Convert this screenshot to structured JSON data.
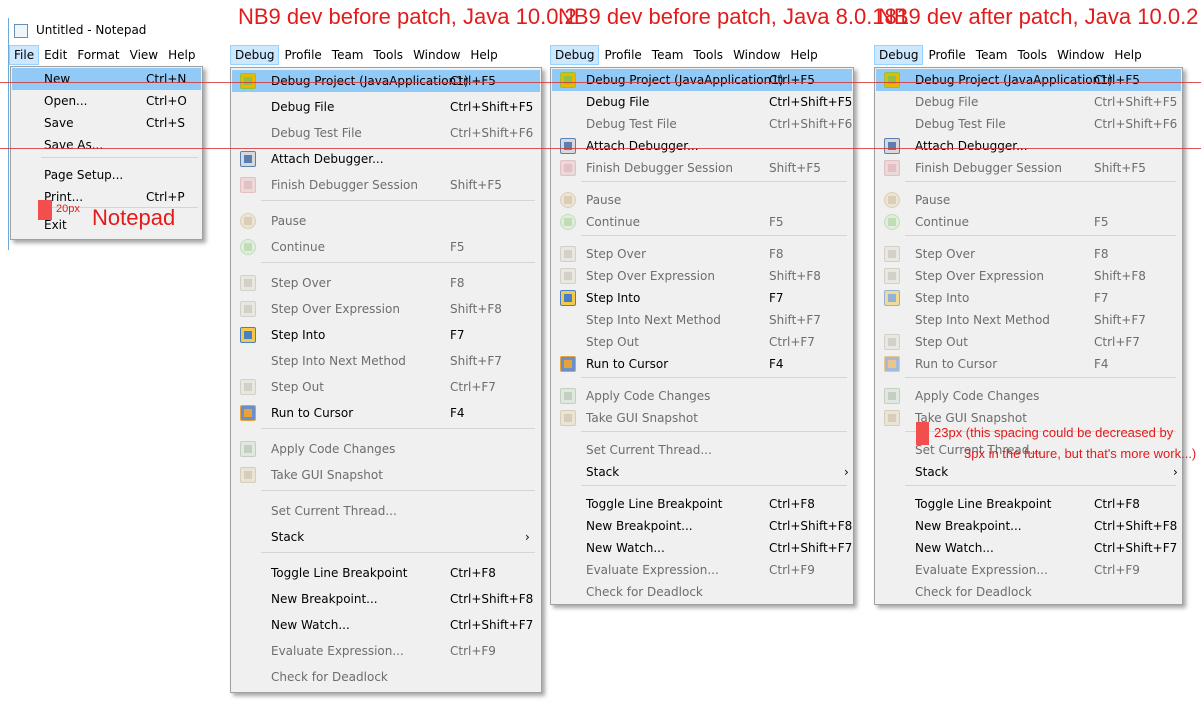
{
  "headings": [
    "NB9 dev before patch, Java 10.0.2",
    "NB9 dev before patch, Java 8.0.181",
    "NB9 dev after patch, Java 10.0.2"
  ],
  "notepad": {
    "title": "Untitled - Notepad",
    "menubar": [
      "File",
      "Edit",
      "Format",
      "View",
      "Help"
    ],
    "menu": [
      {
        "label": "New",
        "acc": "Ctrl+N",
        "selected": true
      },
      {
        "label": "Open...",
        "acc": "Ctrl+O"
      },
      {
        "label": "Save",
        "acc": "Ctrl+S"
      },
      {
        "label": "Save As...",
        "acc": ""
      },
      {
        "label": "Page Setup...",
        "acc": ""
      },
      {
        "label": "Print...",
        "acc": "Ctrl+P"
      },
      {
        "label": "Exit",
        "acc": ""
      }
    ],
    "spacing_note": "20px",
    "label_note": "Notepad"
  },
  "nb_menubar": [
    "Debug",
    "Profile",
    "Team",
    "Tools",
    "Window",
    "Help"
  ],
  "panels": [
    {
      "items": [
        {
          "label": "Debug Project (JavaApplication1)",
          "acc": "Ctrl+F5",
          "icon": "debug-project-icon",
          "selected": true
        },
        {
          "label": "Debug File",
          "acc": "Ctrl+Shift+F5"
        },
        {
          "label": "Debug Test File",
          "acc": "Ctrl+Shift+F6",
          "disabled": true
        },
        {
          "label": "Attach Debugger...",
          "acc": "",
          "icon": "attach-debugger-icon"
        },
        {
          "label": "Finish Debugger Session",
          "acc": "Shift+F5",
          "icon": "finish-session-icon",
          "disabled": true
        },
        {
          "label": "Pause",
          "acc": "",
          "icon": "pause-icon",
          "disabled": true
        },
        {
          "label": "Continue",
          "acc": "F5",
          "icon": "continue-icon",
          "disabled": true
        },
        {
          "label": "Step Over",
          "acc": "F8",
          "icon": "step-over-icon",
          "disabled": true
        },
        {
          "label": "Step Over Expression",
          "acc": "Shift+F8",
          "icon": "step-over-expression-icon",
          "disabled": true
        },
        {
          "label": "Step Into",
          "acc": "F7",
          "icon": "step-into-icon"
        },
        {
          "label": "Step Into Next Method",
          "acc": "Shift+F7",
          "disabled": true
        },
        {
          "label": "Step Out",
          "acc": "Ctrl+F7",
          "icon": "step-out-icon",
          "disabled": true
        },
        {
          "label": "Run to Cursor",
          "acc": "F4",
          "icon": "run-to-cursor-icon"
        },
        {
          "label": "Apply Code Changes",
          "acc": "",
          "icon": "apply-code-changes-icon",
          "disabled": true
        },
        {
          "label": "Take GUI Snapshot",
          "acc": "",
          "icon": "gui-snapshot-icon",
          "disabled": true
        },
        {
          "label": "Set Current Thread...",
          "acc": "",
          "disabled": true
        },
        {
          "label": "Stack",
          "acc": "",
          "submenu": true
        },
        {
          "label": "Toggle Line Breakpoint",
          "acc": "Ctrl+F8"
        },
        {
          "label": "New Breakpoint...",
          "acc": "Ctrl+Shift+F8"
        },
        {
          "label": "New Watch...",
          "acc": "Ctrl+Shift+F7"
        },
        {
          "label": "Evaluate Expression...",
          "acc": "Ctrl+F9",
          "disabled": true
        },
        {
          "label": "Check for Deadlock",
          "acc": "",
          "disabled": true
        }
      ]
    },
    {
      "items": [
        {
          "label": "Debug Project (JavaApplication1)",
          "acc": "Ctrl+F5",
          "icon": "debug-project-icon",
          "selected": true
        },
        {
          "label": "Debug File",
          "acc": "Ctrl+Shift+F5"
        },
        {
          "label": "Debug Test File",
          "acc": "Ctrl+Shift+F6",
          "disabled": true
        },
        {
          "label": "Attach Debugger...",
          "acc": "",
          "icon": "attach-debugger-icon"
        },
        {
          "label": "Finish Debugger Session",
          "acc": "Shift+F5",
          "icon": "finish-session-icon",
          "disabled": true
        },
        {
          "label": "Pause",
          "acc": "",
          "icon": "pause-icon",
          "disabled": true
        },
        {
          "label": "Continue",
          "acc": "F5",
          "icon": "continue-icon",
          "disabled": true
        },
        {
          "label": "Step Over",
          "acc": "F8",
          "icon": "step-over-icon",
          "disabled": true
        },
        {
          "label": "Step Over Expression",
          "acc": "Shift+F8",
          "icon": "step-over-expression-icon",
          "disabled": true
        },
        {
          "label": "Step Into",
          "acc": "F7",
          "icon": "step-into-icon"
        },
        {
          "label": "Step Into Next Method",
          "acc": "Shift+F7",
          "disabled": true
        },
        {
          "label": "Step Out",
          "acc": "Ctrl+F7",
          "disabled": true
        },
        {
          "label": "Run to Cursor",
          "acc": "F4",
          "icon": "run-to-cursor-icon"
        },
        {
          "label": "Apply Code Changes",
          "acc": "",
          "icon": "apply-code-changes-icon",
          "disabled": true
        },
        {
          "label": "Take GUI Snapshot",
          "acc": "",
          "icon": "gui-snapshot-icon",
          "disabled": true
        },
        {
          "label": "Set Current Thread...",
          "acc": "",
          "disabled": true
        },
        {
          "label": "Stack",
          "acc": "",
          "submenu": true
        },
        {
          "label": "Toggle Line Breakpoint",
          "acc": "Ctrl+F8"
        },
        {
          "label": "New Breakpoint...",
          "acc": "Ctrl+Shift+F8"
        },
        {
          "label": "New Watch...",
          "acc": "Ctrl+Shift+F7"
        },
        {
          "label": "Evaluate Expression...",
          "acc": "Ctrl+F9",
          "disabled": true
        },
        {
          "label": "Check for Deadlock",
          "acc": "",
          "disabled": true
        }
      ]
    },
    {
      "items": [
        {
          "label": "Debug Project (JavaApplication1)",
          "acc": "Ctrl+F5",
          "icon": "debug-project-icon",
          "selected": true
        },
        {
          "label": "Debug File",
          "acc": "Ctrl+Shift+F5",
          "disabled": true
        },
        {
          "label": "Debug Test File",
          "acc": "Ctrl+Shift+F6",
          "disabled": true
        },
        {
          "label": "Attach Debugger...",
          "acc": "",
          "icon": "attach-debugger-icon"
        },
        {
          "label": "Finish Debugger Session",
          "acc": "Shift+F5",
          "icon": "finish-session-icon",
          "disabled": true
        },
        {
          "label": "Pause",
          "acc": "",
          "icon": "pause-icon",
          "disabled": true
        },
        {
          "label": "Continue",
          "acc": "F5",
          "icon": "continue-icon",
          "disabled": true
        },
        {
          "label": "Step Over",
          "acc": "F8",
          "icon": "step-over-icon",
          "disabled": true
        },
        {
          "label": "Step Over Expression",
          "acc": "Shift+F8",
          "icon": "step-over-expression-icon",
          "disabled": true
        },
        {
          "label": "Step Into",
          "acc": "F7",
          "icon": "step-into-icon",
          "disabled": true
        },
        {
          "label": "Step Into Next Method",
          "acc": "Shift+F7",
          "disabled": true
        },
        {
          "label": "Step Out",
          "acc": "Ctrl+F7",
          "icon": "step-out-icon",
          "disabled": true
        },
        {
          "label": "Run to Cursor",
          "acc": "F4",
          "icon": "run-to-cursor-icon",
          "disabled": true
        },
        {
          "label": "Apply Code Changes",
          "acc": "",
          "icon": "apply-code-changes-icon",
          "disabled": true
        },
        {
          "label": "Take GUI Snapshot",
          "acc": "",
          "icon": "gui-snapshot-icon",
          "disabled": true
        },
        {
          "label": "Set Current Thread...",
          "acc": "",
          "disabled": true
        },
        {
          "label": "Stack",
          "acc": "",
          "submenu": true
        },
        {
          "label": "Toggle Line Breakpoint",
          "acc": "Ctrl+F8"
        },
        {
          "label": "New Breakpoint...",
          "acc": "Ctrl+Shift+F8"
        },
        {
          "label": "New Watch...",
          "acc": "Ctrl+Shift+F7"
        },
        {
          "label": "Evaluate Expression...",
          "acc": "Ctrl+F9",
          "disabled": true
        },
        {
          "label": "Check for Deadlock",
          "acc": "",
          "disabled": true
        }
      ],
      "note_line1": "23px (this spacing could be decreased by",
      "note_line2": "3px in the future, but that's more work...)"
    }
  ]
}
